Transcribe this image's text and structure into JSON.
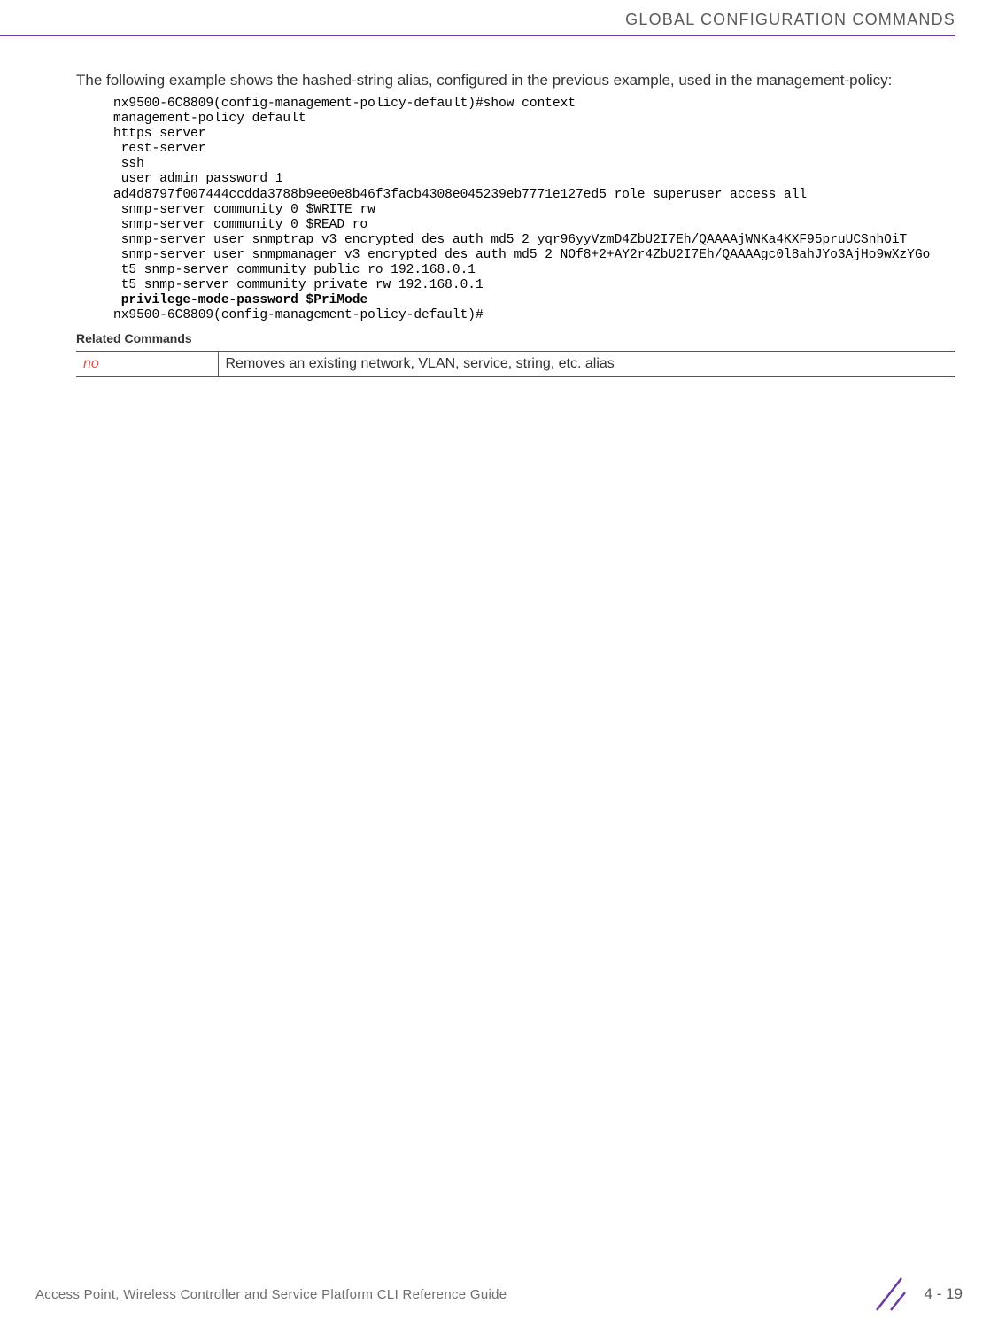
{
  "header": {
    "title": "GLOBAL CONFIGURATION COMMANDS"
  },
  "intro": "The following example shows the hashed-string alias, configured in the previous example, used in the management-policy:",
  "code": {
    "l1": "nx9500-6C8809(config-management-policy-default)#show context",
    "l2": "management-policy default",
    "l3": "https server",
    "l4": " rest-server",
    "l5": " ssh",
    "l6": " user admin password 1 ",
    "l7": "ad4d8797f007444ccdda3788b9ee0e8b46f3facb4308e045239eb7771e127ed5 role superuser access all",
    "l8": " snmp-server community 0 $WRITE rw",
    "l9": " snmp-server community 0 $READ ro",
    "l10": " snmp-server user snmptrap v3 encrypted des auth md5 2 yqr96yyVzmD4ZbU2I7Eh/QAAAAjWNKa4KXF95pruUCSnhOiT",
    "l11": " snmp-server user snmpmanager v3 encrypted des auth md5 2 NOf8+2+AY2r4ZbU2I7Eh/QAAAAgc0l8ahJYo3AjHo9wXzYGo",
    "l12": " t5 snmp-server community public ro 192.168.0.1",
    "l13": " t5 snmp-server community private rw 192.168.0.1",
    "l14": " privilege-mode-password $PriMode",
    "l15": "nx9500-6C8809(config-management-policy-default)#"
  },
  "related": {
    "heading": "Related Commands",
    "row1_cmd": "no",
    "row1_desc": "Removes an existing network, VLAN, service, string, etc. alias"
  },
  "footer": {
    "text": "Access Point, Wireless Controller and Service Platform CLI Reference Guide",
    "page": "4 - 19"
  }
}
